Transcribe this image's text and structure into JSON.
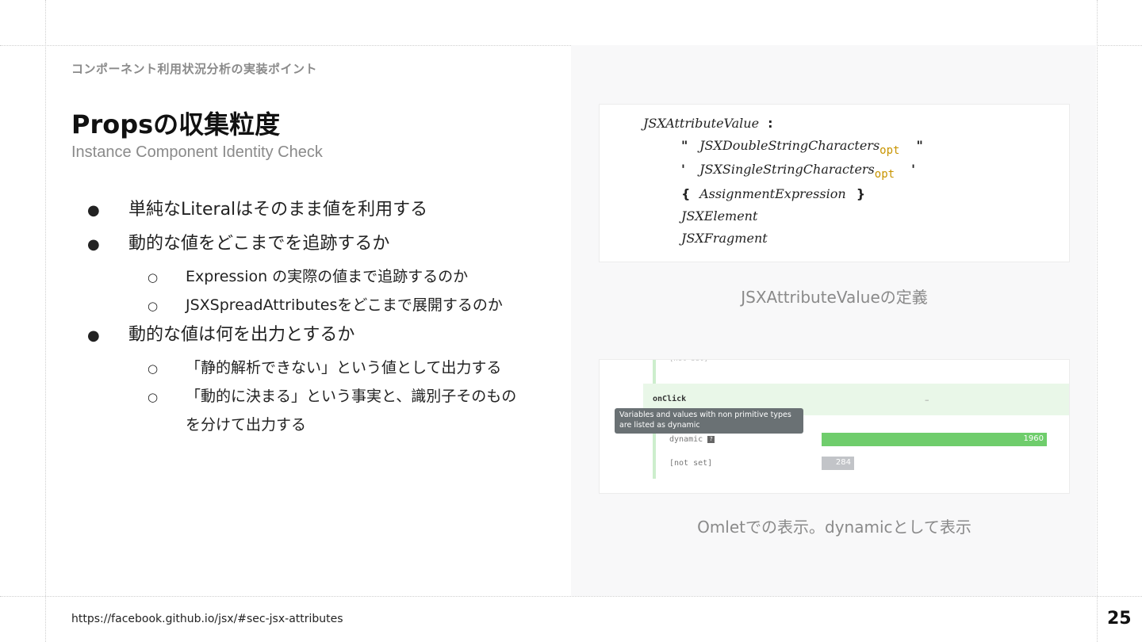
{
  "header": {
    "kicker": "コンポーネント利用状況分析の実装ポイント",
    "title": "Propsの収集粒度",
    "subtitle": "Instance Component Identity Check"
  },
  "bullets": [
    {
      "text": "単純なLiteralはそのまま値を利用する",
      "sub": []
    },
    {
      "text": "動的な値をどこまでを追跡するか",
      "sub": [
        {
          "lines": [
            "Expression の実際の値まで追跡するのか"
          ]
        },
        {
          "lines": [
            "JSXSpreadAttributesをどこまで展開するのか"
          ]
        }
      ]
    },
    {
      "text": "動的な値は何を出力とするか",
      "sub": [
        {
          "lines": [
            "「静的解析できない」という値として出力する"
          ]
        },
        {
          "lines": [
            "「動的に決まる」という事実と、識別子そのもの",
            "を分けて出力する"
          ]
        }
      ]
    }
  ],
  "bullet_marks": {
    "level1": "●",
    "level2": "○"
  },
  "grammar": {
    "head": "JSXAttributeValue",
    "colon": ":",
    "dq": "\"",
    "sq": "'",
    "lbrace": "{",
    "rbrace": "}",
    "opt": "opt",
    "double_string": "JSXDoubleStringCharacters",
    "single_string": "JSXSingleStringCharacters",
    "assignment": "AssignmentExpression",
    "element": "JSXElement",
    "fragment": "JSXFragment"
  },
  "caption_grammar": "JSXAttributeValueの定義",
  "omlet": {
    "prop_name": "onClick",
    "dash": "–",
    "tooltip": "Variables and values with non primitive types are listed as dynamic",
    "rows": [
      {
        "label": "dynamic",
        "help": "?",
        "value": 1960,
        "fraction": 1.0,
        "color": "#6fcd6c"
      },
      {
        "label": "[not set]",
        "value": 284,
        "fraction": 0.145,
        "color": "#c2c4c8"
      }
    ]
  },
  "caption_omlet": "Omletでの表示。dynamicとして表示",
  "footer": {
    "link": "https://facebook.github.io/jsx/#sec-jsx-attributes",
    "page": "25"
  }
}
